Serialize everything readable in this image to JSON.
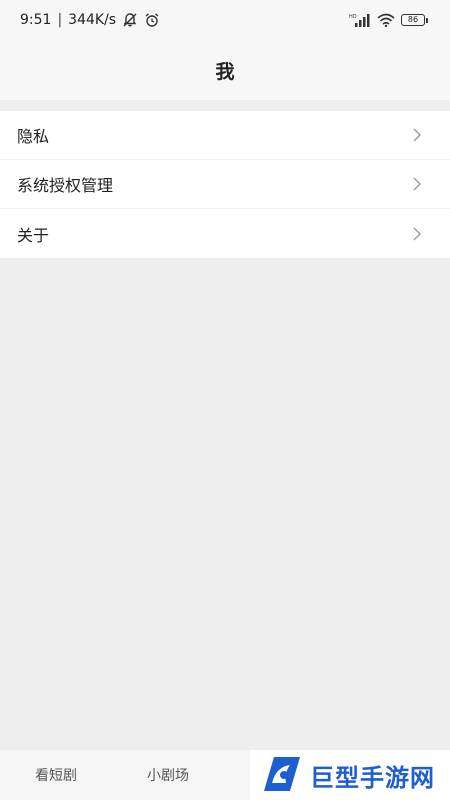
{
  "status_bar": {
    "time": "9:51",
    "network_speed": "344K/s",
    "separator": "|",
    "battery": "86",
    "icons": [
      "bell-off-icon",
      "alarm-icon",
      "hd-signal-icon",
      "wifi-icon",
      "battery-icon"
    ]
  },
  "header": {
    "title": "我"
  },
  "menu": {
    "items": [
      {
        "label": "隐私",
        "icon": "chevron-right-icon"
      },
      {
        "label": "系统授权管理",
        "icon": "chevron-right-icon"
      },
      {
        "label": "关于",
        "icon": "chevron-right-icon"
      }
    ]
  },
  "tab_bar": {
    "tabs": [
      {
        "label": "看短剧"
      },
      {
        "label": "小剧场"
      }
    ]
  },
  "watermark": {
    "text": "巨型手游网",
    "color": "#1d5fd0"
  }
}
